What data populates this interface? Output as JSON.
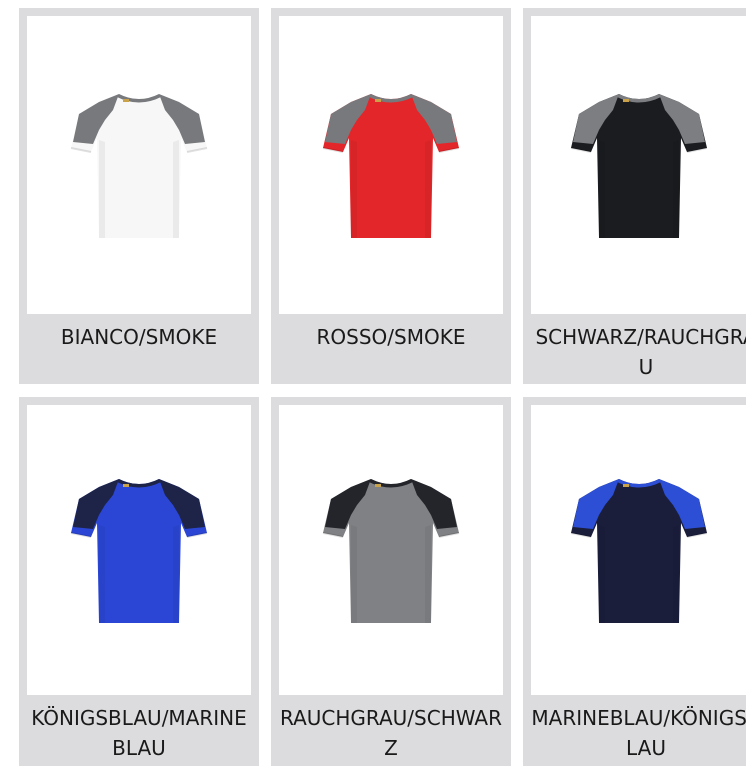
{
  "products": [
    {
      "label": "BIANCO/SMOKE",
      "icon": "white-smoke-tshirt-icon",
      "body_color": "#f7f7f7",
      "accent_color": "#77797c",
      "collar_color": "#77797c"
    },
    {
      "label": "ROSSO/SMOKE",
      "icon": "red-smoke-tshirt-icon",
      "body_color": "#e3262a",
      "accent_color": "#77797c",
      "collar_color": "#77797c"
    },
    {
      "label": "SCHWARZ/RAUCHGRAU",
      "icon": "black-smokegray-tshirt-icon",
      "body_color": "#1b1c20",
      "accent_color": "#7c7e81",
      "collar_color": "#7c7e81"
    },
    {
      "label": "KÖNIGSBLAU/MARINEBLAU",
      "icon": "royalblue-navy-tshirt-icon",
      "body_color": "#2b46d4",
      "accent_color": "#1d2447",
      "collar_color": "#1d2447"
    },
    {
      "label": "RAUCHGRAU/SCHWARZ",
      "icon": "smokegray-black-tshirt-icon",
      "body_color": "#808184",
      "accent_color": "#23252b",
      "collar_color": "#23252b"
    },
    {
      "label": "MARINEBLAU/KÖNIGSBLAU",
      "icon": "navy-royalblue-tshirt-icon",
      "body_color": "#1a1e3b",
      "accent_color": "#2d4fd6",
      "collar_color": "#2d4fd6"
    }
  ]
}
